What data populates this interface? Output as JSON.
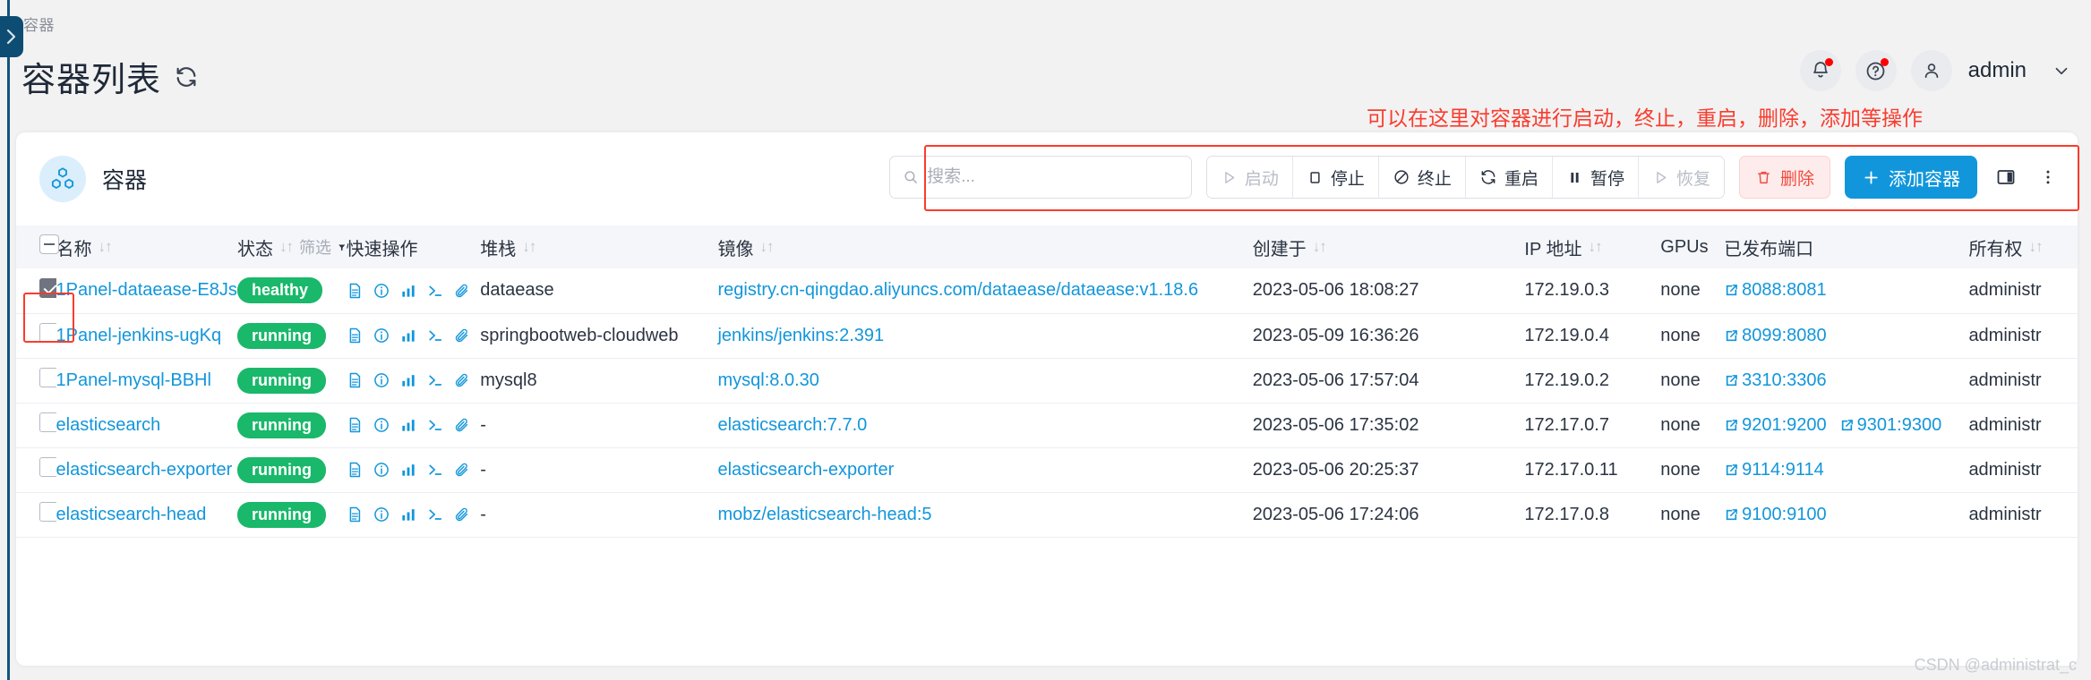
{
  "header": {
    "breadcrumb": "容器",
    "title": "容器列表",
    "refresh_icon": "refresh-icon",
    "user_name": "admin",
    "bell_icon": "bell-icon",
    "help_icon": "help-circle-icon",
    "avatar_icon": "user-icon",
    "chevron_icon": "chevron-down-icon"
  },
  "annotation": "可以在这里对容器进行启动，终止，重启，删除，添加等操作",
  "card": {
    "brand_label": "容器",
    "brand_icon": "cubes-icon"
  },
  "search": {
    "placeholder": "搜索...",
    "value": "",
    "icon": "search-icon"
  },
  "toolbar": {
    "buttons": [
      {
        "label": "启动",
        "icon": "play-icon",
        "disabled": true
      },
      {
        "label": "停止",
        "icon": "square-icon",
        "disabled": false
      },
      {
        "label": "终止",
        "icon": "ban-icon",
        "disabled": false
      },
      {
        "label": "重启",
        "icon": "refresh-icon",
        "disabled": false
      },
      {
        "label": "暂停",
        "icon": "pause-icon",
        "disabled": false
      },
      {
        "label": "恢复",
        "icon": "play-icon",
        "disabled": true
      }
    ],
    "delete_label": "删除",
    "delete_icon": "trash-icon",
    "add_label": "添加容器",
    "add_icon": "plus-icon",
    "columns_icon": "columns-icon",
    "more_icon": "more-vertical-icon"
  },
  "table": {
    "columns": [
      {
        "key": "checkbox",
        "label": "",
        "sortable": false
      },
      {
        "key": "name",
        "label": "名称",
        "sortable": true
      },
      {
        "key": "status",
        "label": "状态",
        "sortable": true,
        "filter_label": "筛选"
      },
      {
        "key": "quick",
        "label": "快速操作",
        "sortable": false
      },
      {
        "key": "stack",
        "label": "堆栈",
        "sortable": true
      },
      {
        "key": "image",
        "label": "镜像",
        "sortable": true
      },
      {
        "key": "created",
        "label": "创建于",
        "sortable": true
      },
      {
        "key": "ip",
        "label": "IP 地址",
        "sortable": true
      },
      {
        "key": "gpus",
        "label": "GPUs",
        "sortable": false
      },
      {
        "key": "ports",
        "label": "已发布端口",
        "sortable": false
      },
      {
        "key": "owner",
        "label": "所有权",
        "sortable": true
      }
    ],
    "quick_action_icons": [
      "file-icon",
      "info-icon",
      "stats-icon",
      "terminal-icon",
      "paperclip-icon"
    ],
    "rows": [
      {
        "selected": true,
        "name": "1Panel-dataease-E8Js",
        "status": "healthy",
        "stack": "dataease",
        "image": "registry.cn-qingdao.aliyuncs.com/dataease/dataease:v1.18.6",
        "created": "2023-05-06 18:08:27",
        "ip": "172.19.0.3",
        "gpus": "none",
        "ports": [
          "8088:8081"
        ],
        "owner": "administr"
      },
      {
        "selected": false,
        "name": "1Panel-jenkins-ugKq",
        "status": "running",
        "stack": "springbootweb-cloudweb",
        "image": "jenkins/jenkins:2.391",
        "created": "2023-05-09 16:36:26",
        "ip": "172.19.0.4",
        "gpus": "none",
        "ports": [
          "8099:8080"
        ],
        "owner": "administr"
      },
      {
        "selected": false,
        "name": "1Panel-mysql-BBHl",
        "status": "running",
        "stack": "mysql8",
        "image": "mysql:8.0.30",
        "created": "2023-05-06 17:57:04",
        "ip": "172.19.0.2",
        "gpus": "none",
        "ports": [
          "3310:3306"
        ],
        "owner": "administr"
      },
      {
        "selected": false,
        "name": "elasticsearch",
        "status": "running",
        "stack": "-",
        "image": "elasticsearch:7.7.0",
        "created": "2023-05-06 17:35:02",
        "ip": "172.17.0.7",
        "gpus": "none",
        "ports": [
          "9201:9200",
          "9301:9300"
        ],
        "owner": "administr"
      },
      {
        "selected": false,
        "name": "elasticsearch-exporter",
        "status": "running",
        "stack": "-",
        "image": "elasticsearch-exporter",
        "created": "2023-05-06 20:25:37",
        "ip": "172.17.0.11",
        "gpus": "none",
        "ports": [
          "9114:9114"
        ],
        "owner": "administr"
      },
      {
        "selected": false,
        "name": "elasticsearch-head",
        "status": "running",
        "stack": "-",
        "image": "mobz/elasticsearch-head:5",
        "created": "2023-05-06 17:24:06",
        "ip": "172.17.0.8",
        "gpus": "none",
        "ports": [
          "9100:9100"
        ],
        "owner": "administr"
      }
    ]
  },
  "watermark": "CSDN @administrat_c",
  "colors": {
    "accent": "#1296db",
    "danger": "#f24a3f",
    "success": "#1ab86a",
    "annotation": "#fa3c2d",
    "rail": "#0d4d74"
  }
}
